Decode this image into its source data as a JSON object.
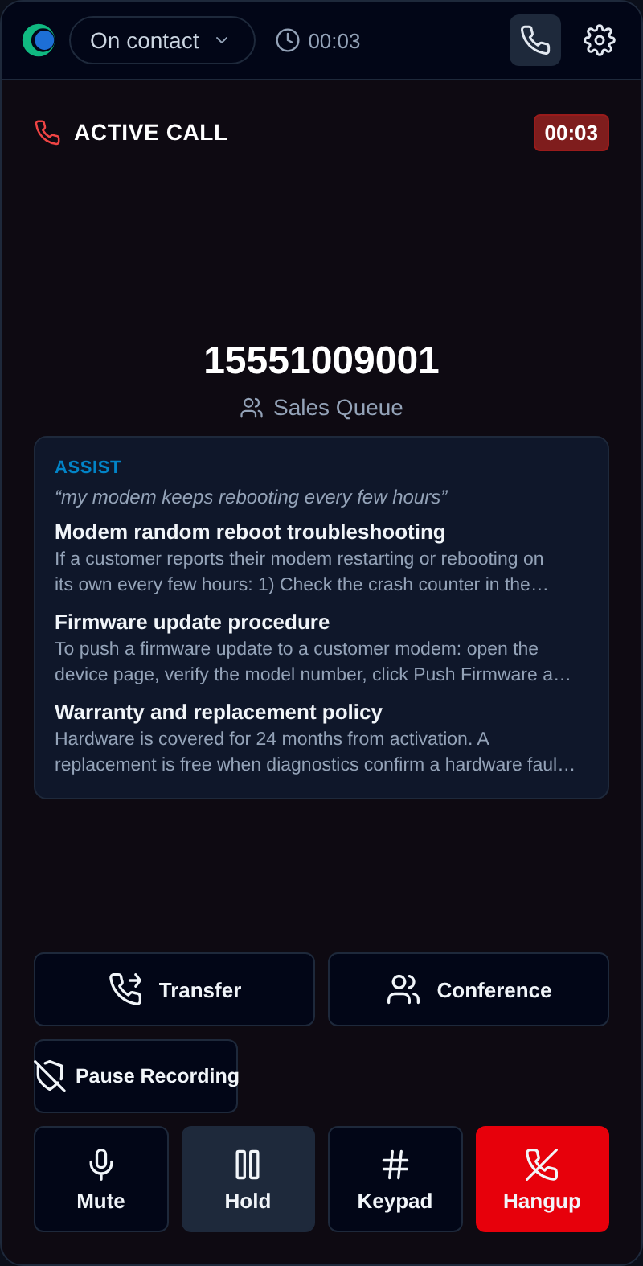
{
  "header": {
    "status": "On contact",
    "timer": "00:03",
    "phone_selected": true
  },
  "call": {
    "label": "ACTIVE CALL",
    "timer": "00:03",
    "number": "15551009001",
    "queue": "Sales Queue"
  },
  "assist": {
    "title": "ASSIST",
    "query": "“my modem keeps rebooting every few hours”",
    "articles": [
      {
        "title": "Modem random reboot troubleshooting",
        "lines": [
          "If a customer reports their modem restarting or rebooting on",
          "its own every few hours: 1) Check the crash counter in the…"
        ]
      },
      {
        "title": "Firmware update procedure",
        "lines": [
          "To push a firmware update to a customer modem: open the",
          "device page, verify the model number, click Push Firmware a…"
        ]
      },
      {
        "title": "Warranty and replacement policy",
        "lines": [
          "Hardware is covered for 24 months from activation. A",
          "replacement is free when diagnostics confirm a hardware faul…"
        ]
      }
    ]
  },
  "actions": [
    {
      "kind": "transfer",
      "label": "Transfer"
    },
    {
      "kind": "conference",
      "label": "Conference"
    }
  ],
  "secondary": [
    {
      "kind": "pause-recording",
      "label": "Pause Recording"
    }
  ],
  "controls": [
    {
      "kind": "mute",
      "label": "Mute",
      "on": false
    },
    {
      "kind": "hold",
      "label": "Hold",
      "on": true
    },
    {
      "kind": "keypad",
      "label": "Keypad",
      "on": false
    },
    {
      "kind": "hangup",
      "label": "Hangup",
      "on": false
    }
  ]
}
